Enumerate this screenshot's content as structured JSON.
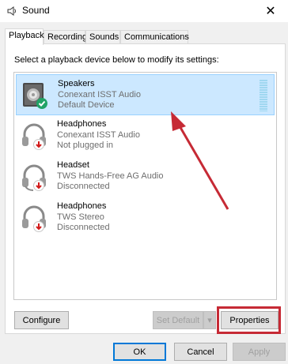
{
  "window": {
    "title": "Sound",
    "icon": "speaker-app-icon",
    "close_glyph": "✕"
  },
  "tabs": [
    {
      "label": "Playback",
      "active": true
    },
    {
      "label": "Recording",
      "active": false
    },
    {
      "label": "Sounds",
      "active": false
    },
    {
      "label": "Communications",
      "active": false
    }
  ],
  "instruction": "Select a playback device below to modify its settings:",
  "devices": [
    {
      "name": "Speakers",
      "driver": "Conexant ISST Audio",
      "status": "Default Device",
      "icon": "speaker-icon",
      "badge": "green-check-badge",
      "selected": true
    },
    {
      "name": "Headphones",
      "driver": "Conexant ISST Audio",
      "status": "Not plugged in",
      "icon": "headphones-icon",
      "badge": "red-down-arrow-badge",
      "selected": false
    },
    {
      "name": "Headset",
      "driver": "TWS Hands-Free AG Audio",
      "status": "Disconnected",
      "icon": "headset-icon",
      "badge": "red-down-arrow-badge",
      "selected": false
    },
    {
      "name": "Headphones",
      "driver": "TWS Stereo",
      "status": "Disconnected",
      "icon": "headphones-icon",
      "badge": "red-down-arrow-badge",
      "selected": false
    }
  ],
  "panel_buttons": {
    "configure": "Configure",
    "set_default": "Set Default",
    "set_default_arrow": "▾",
    "properties": "Properties"
  },
  "dialog_buttons": {
    "ok": "OK",
    "cancel": "Cancel",
    "apply": "Apply"
  },
  "colors": {
    "selection": "#cce8ff",
    "annotation": "#c62a35",
    "focus": "#0078d7"
  }
}
